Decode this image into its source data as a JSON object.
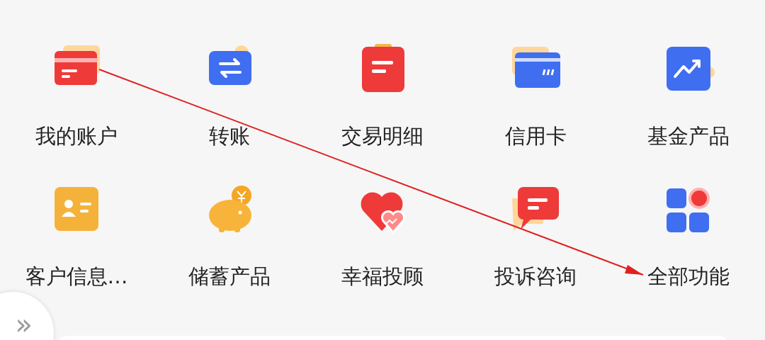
{
  "shortcuts": [
    {
      "label": "我的账户"
    },
    {
      "label": "转账"
    },
    {
      "label": "交易明细"
    },
    {
      "label": "信用卡"
    },
    {
      "label": "基金产品"
    },
    {
      "label": "客户信息…"
    },
    {
      "label": "储蓄产品"
    },
    {
      "label": "幸福投顾"
    },
    {
      "label": "投诉咨询"
    },
    {
      "label": "全部功能"
    }
  ],
  "side_button": {
    "label": "»"
  }
}
